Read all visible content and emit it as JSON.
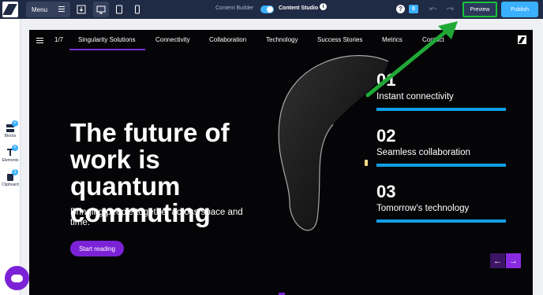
{
  "topbar": {
    "menu_label": "Menu",
    "content_builder_label": "Content Builder",
    "content_studio_label": "Content Studio",
    "info_symbol": "i",
    "help_symbol": "?",
    "badge_count": "0",
    "preview_label": "Preview",
    "publish_label": "Publish"
  },
  "sidebar": {
    "items": [
      {
        "label": "Blocks",
        "icon": "blocks-icon"
      },
      {
        "label": "Elements",
        "icon": "elements-icon"
      },
      {
        "label": "Clipboard",
        "icon": "clipboard-icon",
        "count": "1"
      }
    ]
  },
  "canvas": {
    "nav": {
      "counter": "1/7",
      "items": [
        "Singularity Solutions",
        "Connectivity",
        "Collaboration",
        "Technology",
        "Success Stories",
        "Metrics",
        "Contact"
      ]
    },
    "hero": {
      "title_line1": "The future of",
      "title_line2": "work is quantum",
      "title_line3": "commuting",
      "subtitle": "Bringing people together across space and time.",
      "cta_label": "Start reading"
    },
    "stats": [
      {
        "number": "01",
        "label": "Instant connectivity"
      },
      {
        "number": "02",
        "label": "Seamless collaboration"
      },
      {
        "number": "03",
        "label": "Tomorrow's technology"
      }
    ]
  },
  "colors": {
    "topbar": "#1f2a44",
    "accent_blue": "#3ab0ff",
    "highlight_green": "#17c33b",
    "purple": "#7b22d6",
    "stat_bar": "#119ee8"
  }
}
